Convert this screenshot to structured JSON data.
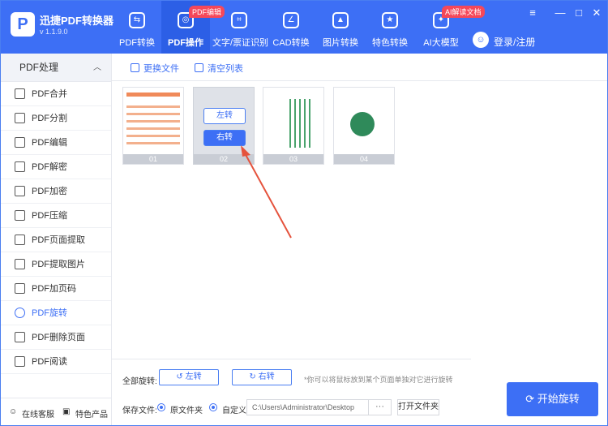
{
  "app": {
    "name": "迅捷PDF转换器",
    "version": "v 1.1.9.0",
    "logo": "P"
  },
  "tabs": [
    {
      "label": "PDF转换",
      "badge": ""
    },
    {
      "label": "PDF操作",
      "badge": "PDF编辑"
    },
    {
      "label": "文字/票证识别",
      "badge": ""
    },
    {
      "label": "CAD转换",
      "badge": ""
    },
    {
      "label": "图片转换",
      "badge": ""
    },
    {
      "label": "特色转换",
      "badge": ""
    },
    {
      "label": "AI大模型",
      "badge": "AI解读文档"
    }
  ],
  "user": {
    "login": "登录/注册"
  },
  "window": {
    "menu": "≡",
    "min": "—",
    "max": "□",
    "close": "✕"
  },
  "sidebar": {
    "title": "PDF处理",
    "items": [
      "PDF合并",
      "PDF分割",
      "PDF编辑",
      "PDF解密",
      "PDF加密",
      "PDF压缩",
      "PDF页面提取",
      "PDF提取图片",
      "PDF加页码",
      "PDF旋转",
      "PDF删除页面",
      "PDF阅读"
    ],
    "active_index": 9,
    "footer": {
      "service": "在线客服",
      "products": "特色产品"
    }
  },
  "toolbar": {
    "replace": "更换文件",
    "clear": "清空列表"
  },
  "pages": [
    {
      "num": "01"
    },
    {
      "num": "02",
      "rotate_left": "左转",
      "rotate_right": "右转"
    },
    {
      "num": "03"
    },
    {
      "num": "04"
    }
  ],
  "rotate_all": {
    "label": "全部旋转:",
    "left": "左转",
    "right": "右转",
    "hint": "*你可以将鼠标放到某个页面单独对它进行旋转"
  },
  "save": {
    "label": "保存文件:",
    "opt_source": "原文件夹",
    "opt_custom": "自定义",
    "path": "C:\\Users\\Administrator\\Desktop",
    "browse": "···",
    "open_folder": "打开文件夹"
  },
  "start": {
    "label": "开始旋转"
  },
  "colors": {
    "brand": "#3d6ff5",
    "badge": "#f5485a",
    "arrow": "#e5533d"
  }
}
